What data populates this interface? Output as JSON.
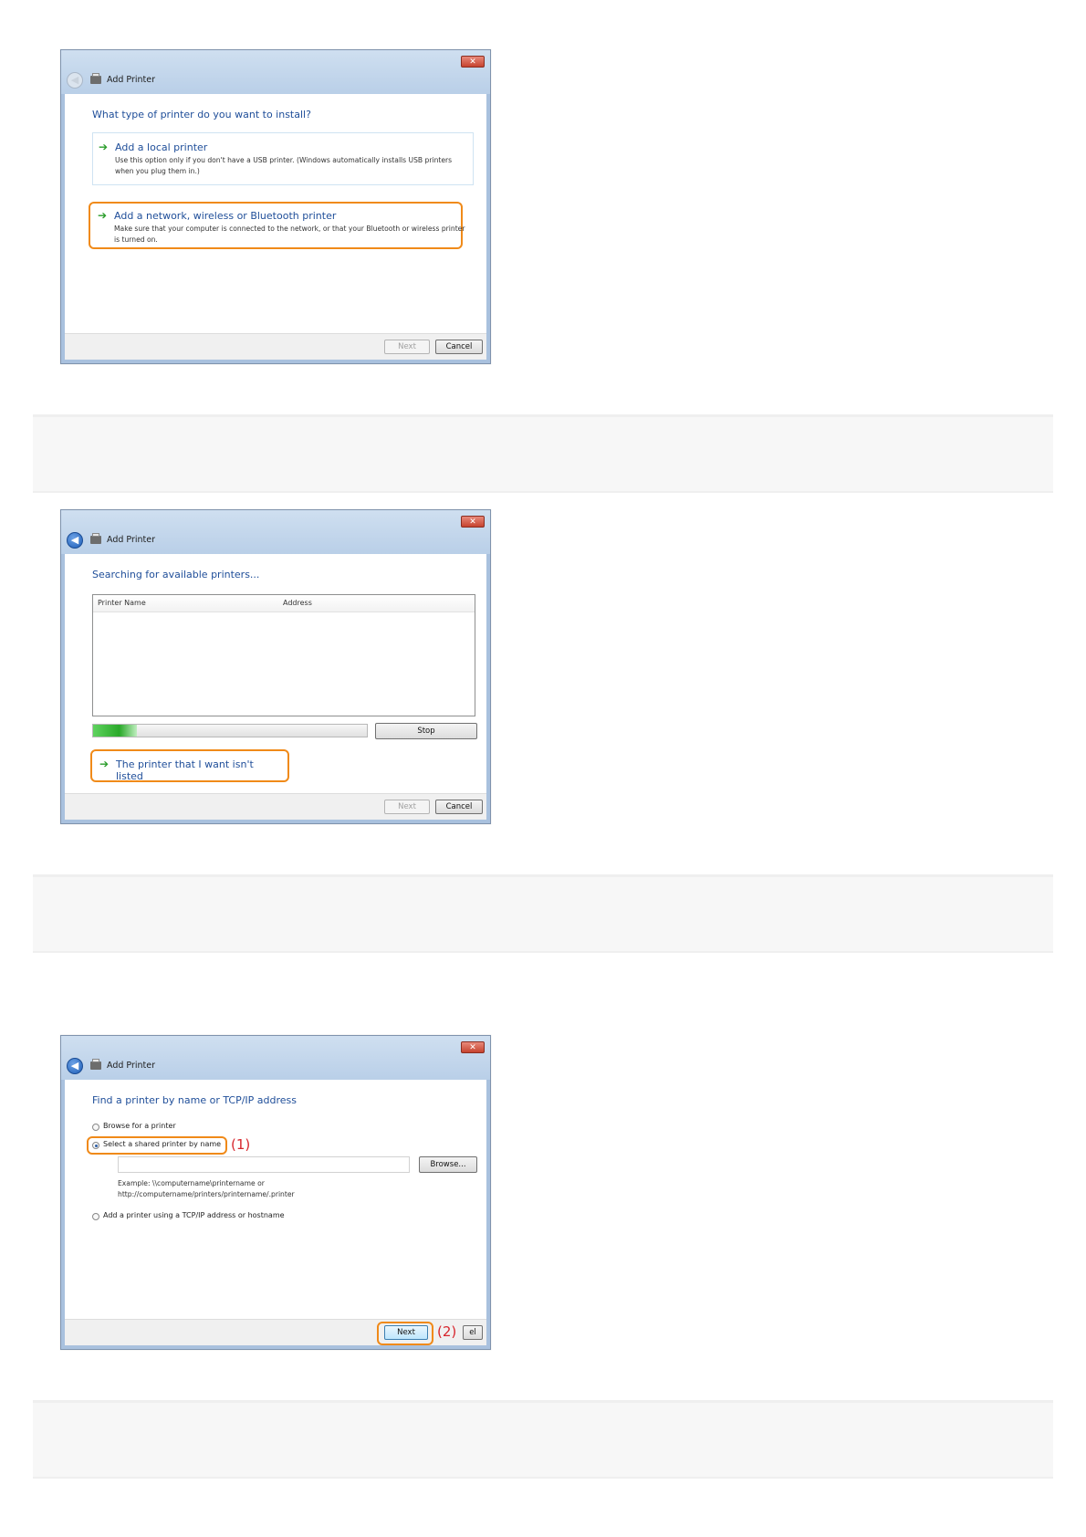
{
  "dialog1": {
    "title": "Add Printer",
    "close": "✕",
    "back": "◀",
    "heading": "What type of printer do you want to install?",
    "option_local": {
      "title": "Add a local printer",
      "desc": "Use this option only if you don't have a USB printer. (Windows automatically installs USB printers when you plug them in.)"
    },
    "option_network": {
      "title": "Add a network, wireless or Bluetooth printer",
      "desc": "Make sure that your computer is connected to the network, or that your Bluetooth or wireless printer is turned on."
    },
    "next_label": "Next",
    "cancel_label": "Cancel"
  },
  "dialog2": {
    "title": "Add Printer",
    "close": "✕",
    "back": "◀",
    "heading": "Searching for available printers...",
    "columns": [
      "Printer Name",
      "Address"
    ],
    "progress": 0.16,
    "stop_label": "Stop",
    "not_listed_label": "The printer that I want isn't listed",
    "next_label": "Next",
    "cancel_label": "Cancel"
  },
  "dialog3": {
    "title": "Add Printer",
    "close": "✕",
    "back": "◀",
    "heading": "Find a printer by name or TCP/IP address",
    "radio_browse": "Browse for a printer",
    "radio_shared": "Select a shared printer by name",
    "radio_tcpip": "Add a printer using a TCP/IP address or hostname",
    "shared_value": "",
    "browse_label": "Browse...",
    "example_line1": "Example: \\\\computername\\printername or",
    "example_line2": "http://computername/printers/printername/.printer",
    "callout1": "(1)",
    "callout2": "(2)",
    "next_label": "Next",
    "cancel_partial": "el"
  },
  "icons": {
    "arrow": "➔"
  },
  "colors": {
    "highlight": "#f08a19",
    "heading_blue": "#1f4e99",
    "callout_red": "#d7262d"
  }
}
